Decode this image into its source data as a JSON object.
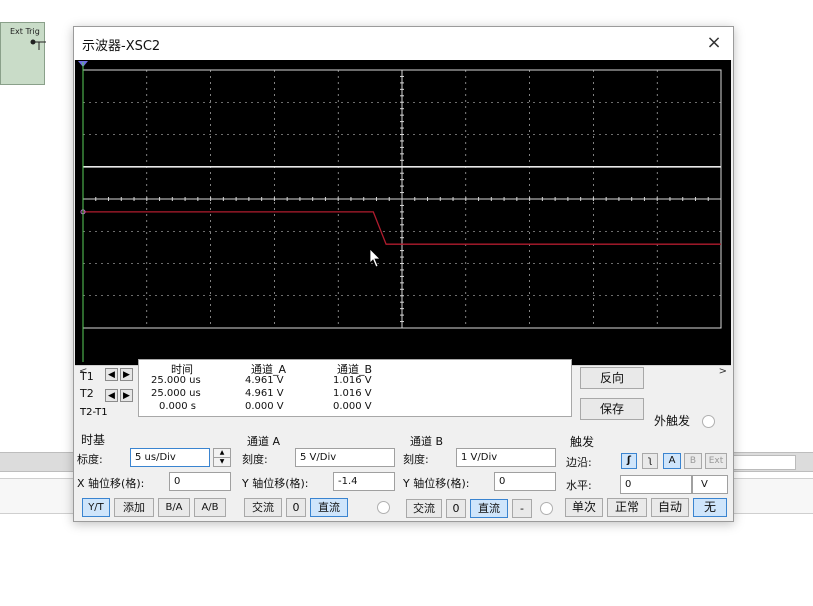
{
  "background": {
    "ext_trig_label": "Ext Trig"
  },
  "window": {
    "title": "示波器-XSC2",
    "close_glyph": "×"
  },
  "scroll": {
    "left": "<",
    "right": ">"
  },
  "readout": {
    "time_header": "时间",
    "cha_header": "通道_A",
    "chb_header": "通道_B",
    "rows": [
      {
        "label": "T1",
        "time": "25.000 us",
        "cha": "4.961 V",
        "chb": "1.016 V"
      },
      {
        "label": "T2",
        "time": "25.000 us",
        "cha": "4.961 V",
        "chb": "1.016 V"
      },
      {
        "label": "T2-T1",
        "time": "0.000 s",
        "cha": "0.000 V",
        "chb": "0.000 V"
      }
    ]
  },
  "buttons": {
    "reverse": "反向",
    "save": "保存",
    "ext_trigger": "外触发"
  },
  "timebase": {
    "title": "时基",
    "scale_label": "标度:",
    "scale_value": "5 us/Div",
    "xpos_label": "X 轴位移(格):",
    "xpos_value": "0",
    "modes": [
      "Y/T",
      "添加",
      "B/A",
      "A/B"
    ],
    "active_mode": 0
  },
  "channel_a": {
    "title": "通道 A",
    "scale_label": "刻度:",
    "scale_value": "5  V/Div",
    "ypos_label": "Y 轴位移(格):",
    "ypos_value": "-1.4",
    "coupling": [
      "交流",
      "0",
      "直流"
    ],
    "active_coupling": 2
  },
  "channel_b": {
    "title": "通道 B",
    "scale_label": "刻度:",
    "scale_value": "1  V/Div",
    "ypos_label": "Y 轴位移(格):",
    "ypos_value": "0",
    "coupling": [
      "交流",
      "0",
      "直流",
      "-"
    ],
    "active_coupling": 2
  },
  "trigger": {
    "title": "触发",
    "edge_label": "边沿:",
    "edge_rise": "ʃ",
    "edge_fall": "ʅ",
    "sources": [
      "A",
      "B",
      "Ext"
    ],
    "active_source": 0,
    "level_label": "水平:",
    "level_value": "0",
    "level_unit": "V",
    "modes": [
      "单次",
      "正常",
      "自动",
      "无"
    ],
    "active_mode": 3
  },
  "colors": {
    "screen_bg": "#000000",
    "grid": "#d8d8d8",
    "trace_a": "#b01c2e",
    "trace_b": "#e8e8e8",
    "cursor_t1": "#5ad05a"
  },
  "chart_data": {
    "type": "line",
    "x_divisions": 10,
    "y_divisions": 8,
    "series": [
      {
        "channel": "A",
        "points": [
          [
            0,
            -0.4
          ],
          [
            4.55,
            -0.4
          ],
          [
            4.75,
            -1.4
          ],
          [
            10,
            -1.4
          ]
        ]
      },
      {
        "channel": "B",
        "points": [
          [
            0,
            1.0
          ],
          [
            5.0,
            1.0
          ],
          [
            10,
            1.0
          ]
        ]
      }
    ]
  }
}
